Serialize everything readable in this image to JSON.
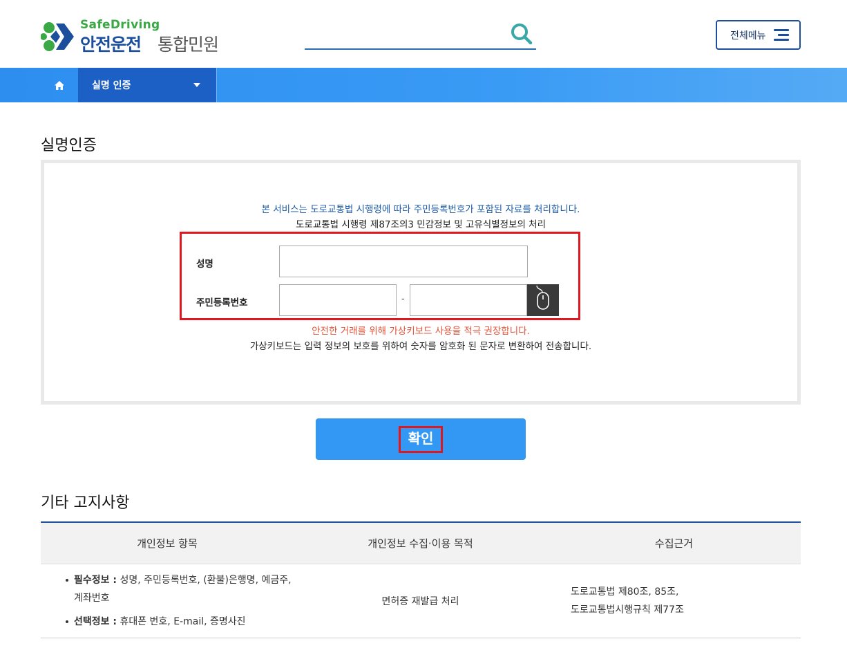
{
  "header": {
    "logo_en": "SafeDriving",
    "logo_ko_bold": "안전운전",
    "logo_ko": "통합민원",
    "search_placeholder": "",
    "menu_label": "전체메뉴"
  },
  "nav": {
    "current": "실명 인증"
  },
  "auth": {
    "title": "실명인증",
    "notice_line1": "본 서비스는 도로교통법 시행령에 따라 주민등록번호가 포함된 자료를 처리합니다.",
    "notice_line2": "도로교통법 시행령 제87조의3 민감정보 및 고유식별정보의 처리",
    "name_label": "성명",
    "name_value": "",
    "rrn_label": "주민등록번호",
    "rrn_front": "",
    "rrn_dash": "-",
    "rrn_back": "",
    "warning": "안전한 거래를 위해 가상키보드 사용을 적극 권장합니다.",
    "info": "가상키보드는 입력 정보의 보호를 위하여 숫자를 암호화 된 문자로 변환하여 전송합니다.",
    "confirm_label": "확인"
  },
  "notices": {
    "title": "기타 고지사항",
    "headers": [
      "개인정보 항목",
      "개인정보 수집·이용 목적",
      "수집근거"
    ],
    "required_label": "필수정보 :",
    "required_text": " 성명, 주민등록번호, (환불)은행명, 예금주, 계좌번호",
    "optional_label": "선택정보 :",
    "optional_text": " 휴대폰 번호, E-mail, 증명사진",
    "purpose": "면허증 재발급 처리",
    "basis_line1": "도로교통법 제80조, 85조,",
    "basis_line2": "도로교통법시행규칙 제77조"
  },
  "colors": {
    "brand_blue": "#1b4f9c",
    "brand_green": "#3aa845",
    "nav_blue": "#2d8ef0",
    "button_blue": "#3398f3",
    "highlight_red": "#e0171f",
    "warning_orange": "#e2553b"
  }
}
